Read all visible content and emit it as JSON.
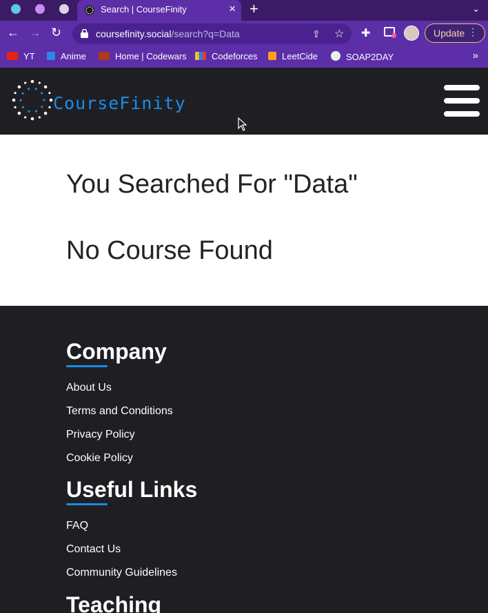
{
  "browser": {
    "tab_title": "Search | CourseFinity",
    "url_domain": "coursefinity.social",
    "url_path": "/search?q=Data",
    "update_label": "Update",
    "bookmarks": [
      "YT",
      "Anime",
      "Home | Codewars",
      "Codeforces",
      "LeetCide",
      "SOAP2DAY"
    ]
  },
  "site": {
    "logo_text": "CourseFinity"
  },
  "result": {
    "heading": "You Searched For \"Data\"",
    "message": "No Course Found"
  },
  "footer": {
    "company_heading": "Company",
    "company_links": [
      "About Us",
      "Terms and Conditions",
      "Privacy Policy",
      "Cookie Policy"
    ],
    "useful_heading": "Useful Links",
    "useful_links": [
      "FAQ",
      "Contact Us",
      "Community Guidelines"
    ],
    "teaching_heading": "Teaching"
  },
  "colors": {
    "browser_frame": "#5c2ea8",
    "brand_blue": "#1c8be8",
    "dark_bg": "#1f1f23"
  }
}
